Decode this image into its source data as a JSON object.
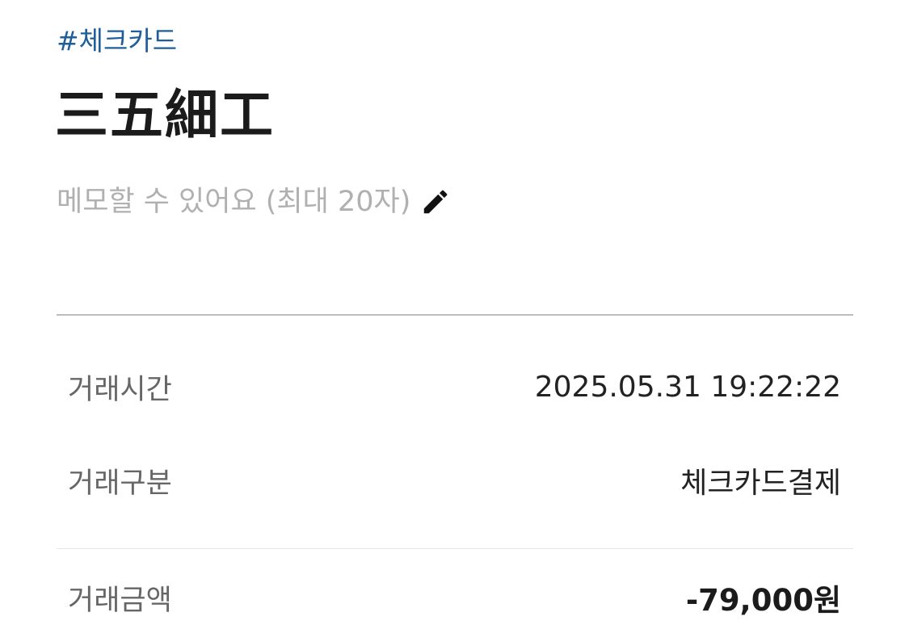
{
  "header": {
    "tag": "#체크카드",
    "merchant_name": "三五細工",
    "memo_placeholder": "메모할 수 있어요 (최대 20자)",
    "memo_icon": "pencil-icon"
  },
  "details": [
    {
      "label": "거래시간",
      "value": "2025.05.31 19:22:22"
    },
    {
      "label": "거래구분",
      "value": "체크카드결제"
    },
    {
      "label": "거래금액",
      "value": "-79,000원"
    }
  ],
  "colors": {
    "tag": "#1f5e99",
    "title": "#1b1b1b",
    "placeholder": "#b0b0b0",
    "label": "#666666",
    "value": "#222222"
  }
}
